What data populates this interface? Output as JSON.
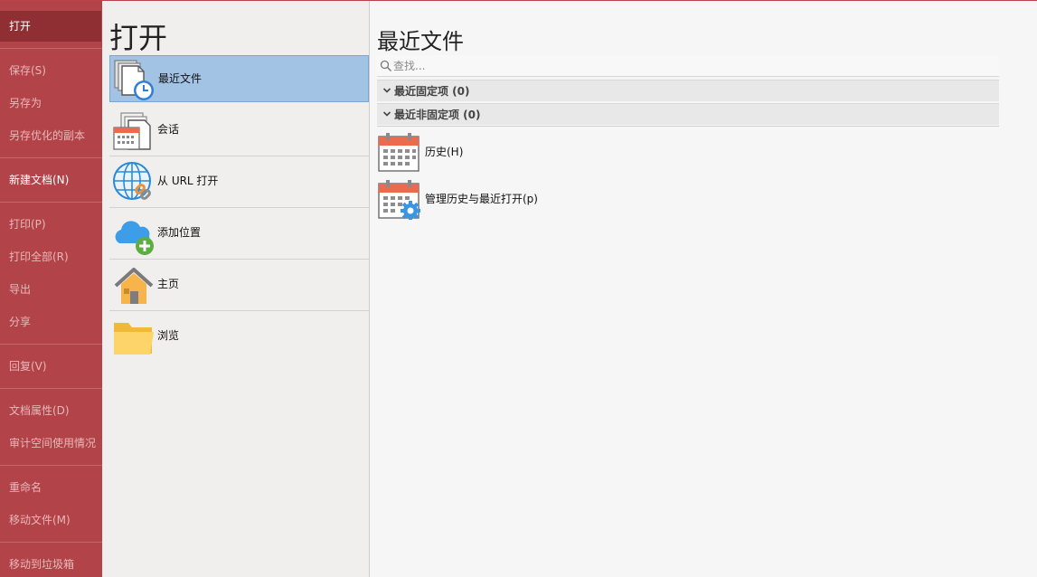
{
  "sidebar": {
    "items": [
      {
        "label": "打开"
      },
      {
        "label": "保存(S)"
      },
      {
        "label": "另存为"
      },
      {
        "label": "另存优化的副本"
      },
      {
        "label": "新建文档(N)"
      },
      {
        "label": "打印(P)"
      },
      {
        "label": "打印全部(R)"
      },
      {
        "label": "导出"
      },
      {
        "label": "分享"
      },
      {
        "label": "回复(V)"
      },
      {
        "label": "文档属性(D)"
      },
      {
        "label": "审计空间使用情况"
      },
      {
        "label": "重命名"
      },
      {
        "label": "移动文件(M)"
      },
      {
        "label": "移动到垃圾箱"
      }
    ]
  },
  "open_panel": {
    "title": "打开",
    "options": [
      {
        "label": "最近文件",
        "icon": "recent-files-clock-icon"
      },
      {
        "label": "会话",
        "icon": "session-calendar-icon"
      },
      {
        "label": "从 URL 打开",
        "icon": "globe-link-icon"
      },
      {
        "label": "添加位置",
        "icon": "cloud-add-icon"
      },
      {
        "label": "主页",
        "icon": "home-icon"
      },
      {
        "label": "浏览",
        "icon": "folder-icon"
      }
    ]
  },
  "recent": {
    "title": "最近文件",
    "search_placeholder": "查找...",
    "pinned_label": "最近固定项 (0)",
    "unpinned_label": "最近非固定项 (0)",
    "entries": [
      {
        "label": "历史(H)",
        "icon": "calendar-icon"
      },
      {
        "label": "管理历史与最近打开(p)",
        "icon": "calendar-gear-icon"
      }
    ]
  },
  "colors": {
    "sidebar_bg": "#b24449",
    "sidebar_active": "#8f2e33",
    "selected_option": "#a3c3e4"
  }
}
